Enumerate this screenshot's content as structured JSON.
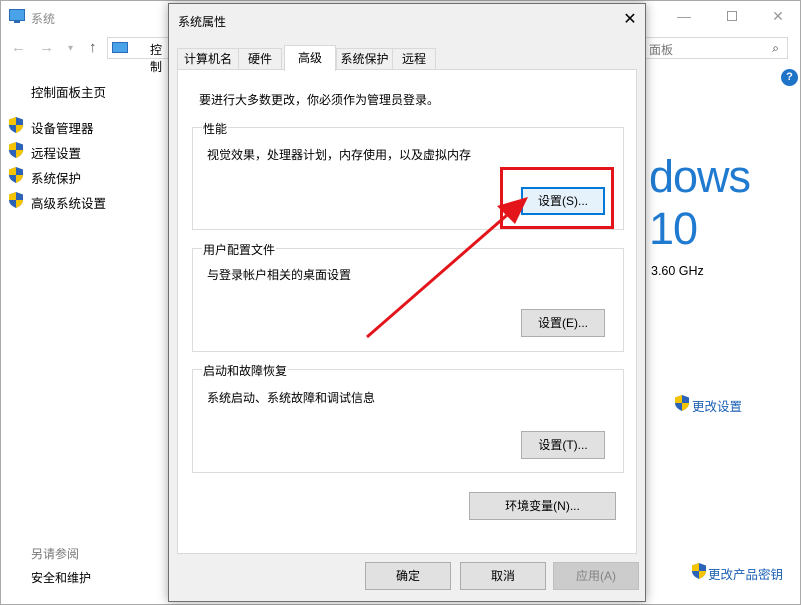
{
  "background_window": {
    "title": "系统",
    "address_text": "控制",
    "search_placeholder": "面板",
    "sidebar": {
      "home": "控制面板主页",
      "links": [
        "设备管理器",
        "远程设置",
        "系统保护",
        "高级系统设置"
      ],
      "see_also": "另请参阅",
      "bottom_link": "安全和维护"
    },
    "brand_text": "dows 10",
    "cpu_speed": "3.60 GHz",
    "change_settings": "更改设置",
    "change_product_key": "更改产品密钥"
  },
  "dialog": {
    "title": "系统属性",
    "tabs": [
      "计算机名",
      "硬件",
      "高级",
      "系统保护",
      "远程"
    ],
    "active_tab": "高级",
    "intro": "要进行大多数更改，你必须作为管理员登录。",
    "performance": {
      "title": "性能",
      "description": "视觉效果，处理器计划，内存使用，以及虚拟内存",
      "button": "设置(S)..."
    },
    "user_profiles": {
      "title": "用户配置文件",
      "description": "与登录帐户相关的桌面设置",
      "button": "设置(E)..."
    },
    "startup_recovery": {
      "title": "启动和故障恢复",
      "description": "系统启动、系统故障和调试信息",
      "button": "设置(T)..."
    },
    "env_button": "环境变量(N)...",
    "ok": "确定",
    "cancel": "取消",
    "apply": "应用(A)"
  },
  "colors": {
    "annotation_red": "#e3151b",
    "link_blue": "#1a5fb4",
    "win_blue": "#1f7ad0",
    "focus_blue": "#0078d7"
  },
  "icons": {
    "close": "close-icon",
    "shield": "uac-shield-icon",
    "help": "help-icon",
    "search": "search-icon"
  }
}
